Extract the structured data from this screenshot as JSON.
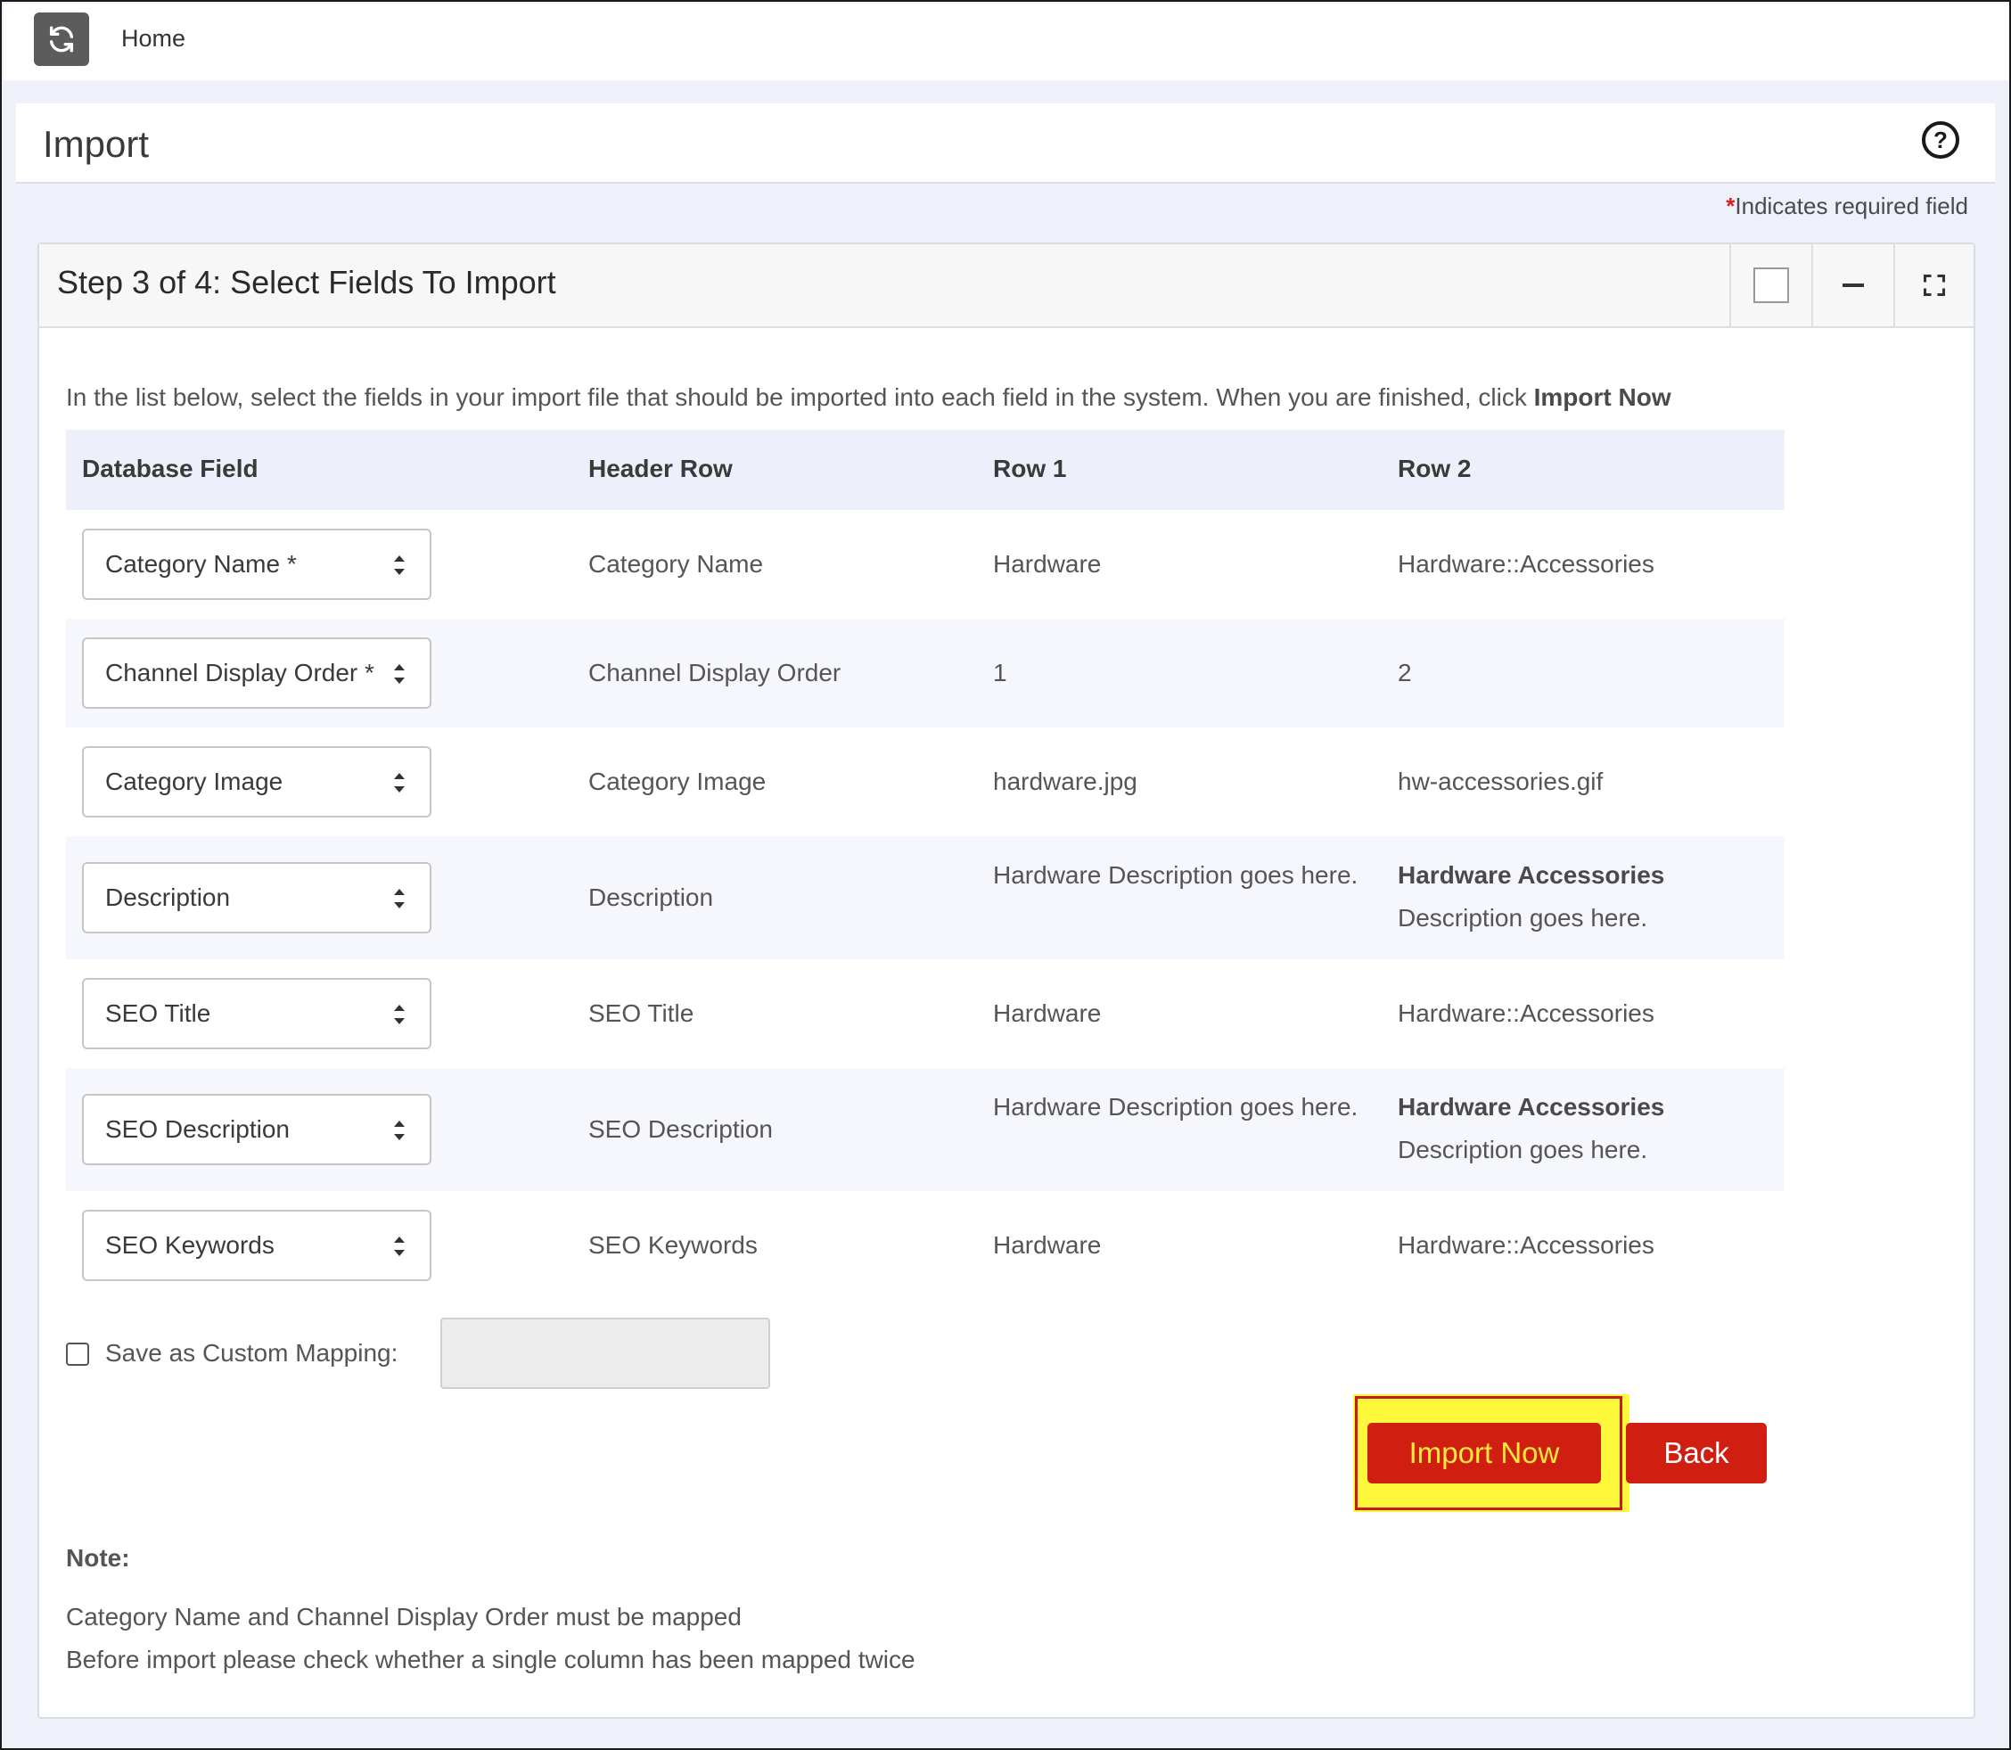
{
  "topbar": {
    "refresh_icon": "refresh-icon",
    "home_label": "Home"
  },
  "header": {
    "title": "Import",
    "help_icon": "question-circle-icon"
  },
  "required_note": {
    "star": "*",
    "text": "Indicates required field"
  },
  "panel": {
    "title": "Step 3 of 4: Select Fields To Import",
    "tools": [
      "checkbox-square-icon",
      "minimize-icon",
      "expand-icon"
    ],
    "intro_text": "In the list below, select the fields in your import file that should be imported into each field in the system. When you are finished, click ",
    "intro_bold": "Import Now"
  },
  "table": {
    "columns": [
      "Database Field",
      "Header Row",
      "Row 1",
      "Row 2"
    ],
    "rows": [
      {
        "field": "Category Name *",
        "header": "Category Name",
        "row1": "Hardware",
        "row2_bold": "",
        "row2": "Hardware::Accessories"
      },
      {
        "field": "Channel Display Order *",
        "header": "Channel Display Order",
        "row1": "1",
        "row2_bold": "",
        "row2": "2"
      },
      {
        "field": "Category Image",
        "header": "Category Image",
        "row1": "hardware.jpg",
        "row2_bold": "",
        "row2": "hw-accessories.gif"
      },
      {
        "field": "Description",
        "header": "Description",
        "row1": "Hardware Description goes here.",
        "row2_bold": "Hardware Accessories",
        "row2": " Description goes here."
      },
      {
        "field": "SEO Title",
        "header": "SEO Title",
        "row1": "Hardware",
        "row2_bold": "",
        "row2": "Hardware::Accessories"
      },
      {
        "field": "SEO Description",
        "header": "SEO Description",
        "row1": "Hardware Description goes here.",
        "row2_bold": "Hardware Accessories",
        "row2": " Description goes here."
      },
      {
        "field": "SEO Keywords",
        "header": "SEO Keywords",
        "row1": "Hardware",
        "row2_bold": "",
        "row2": "Hardware::Accessories"
      }
    ]
  },
  "save_mapping": {
    "label": "Save as Custom Mapping:",
    "checked": false,
    "value": ""
  },
  "buttons": {
    "import_now": "Import Now",
    "back": "Back"
  },
  "note": {
    "title": "Note:",
    "lines": [
      "Category Name and Channel Display Order must be mapped",
      "Before import please check whether a single column has been mapped twice"
    ]
  }
}
